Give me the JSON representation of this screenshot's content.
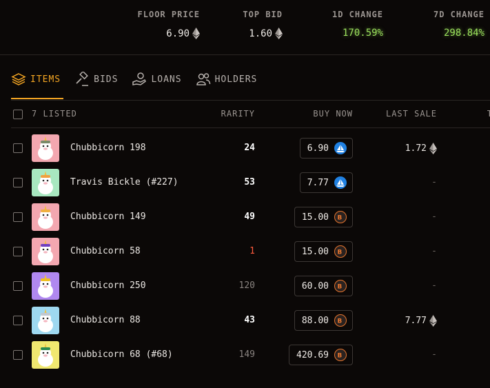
{
  "stats": [
    {
      "label": "FLOOR PRICE",
      "value": "6.90",
      "eth": true
    },
    {
      "label": "TOP BID",
      "value": "1.60",
      "eth": true
    },
    {
      "label": "1D CHANGE",
      "value": "170.59%",
      "eth": false
    },
    {
      "label": "7D CHANGE",
      "value": "298.84%",
      "eth": false
    }
  ],
  "tabs": [
    {
      "label": "ITEMS",
      "icon": "layers-icon",
      "active": true
    },
    {
      "label": "BIDS",
      "icon": "gavel-icon",
      "active": false
    },
    {
      "label": "LOANS",
      "icon": "loan-hand-icon",
      "active": false
    },
    {
      "label": "HOLDERS",
      "icon": "users-icon",
      "active": false
    }
  ],
  "table": {
    "headers": {
      "listed": "7 LISTED",
      "rarity": "RARITY",
      "buy_now": "BUY NOW",
      "last_sale": "LAST SALE",
      "truncated": "T"
    },
    "rows": [
      {
        "name": "Chubbicorn 198",
        "rarity": "24",
        "rarity_style": "bold",
        "price": "6.90",
        "market": "opensea",
        "last_sale": "1.72",
        "last_eth": true,
        "thumb_bg": "#f3a7b0",
        "accent": "#7a8a6a"
      },
      {
        "name": "Travis Bickle (#227)",
        "rarity": "53",
        "rarity_style": "bold",
        "price": "7.77",
        "market": "opensea",
        "last_sale": "-",
        "last_eth": false,
        "thumb_bg": "#a8e8c0",
        "accent": "#f0a040"
      },
      {
        "name": "Chubbicorn 149",
        "rarity": "49",
        "rarity_style": "bold",
        "price": "15.00",
        "market": "blur",
        "last_sale": "-",
        "last_eth": false,
        "thumb_bg": "#f3a7b0",
        "accent": "#f0b040"
      },
      {
        "name": "Chubbicorn 58",
        "rarity": "1",
        "rarity_style": "red",
        "price": "15.00",
        "market": "blur",
        "last_sale": "-",
        "last_eth": false,
        "thumb_bg": "#f3a7b0",
        "accent": "#7040c0"
      },
      {
        "name": "Chubbicorn 250",
        "rarity": "120",
        "rarity_style": "dim",
        "price": "60.00",
        "market": "blur",
        "last_sale": "-",
        "last_eth": false,
        "thumb_bg": "#b088f0",
        "accent": "#f0c020"
      },
      {
        "name": "Chubbicorn 88",
        "rarity": "43",
        "rarity_style": "bold",
        "price": "88.00",
        "market": "blur",
        "last_sale": "7.77",
        "last_eth": true,
        "thumb_bg": "#9ed8f0",
        "accent": "#c0c8d0"
      },
      {
        "name": "Chubbicorn 68 (#68)",
        "rarity": "149",
        "rarity_style": "dim",
        "price": "420.69",
        "market": "blur",
        "last_sale": "-",
        "last_eth": false,
        "thumb_bg": "#f0e870",
        "accent": "#2a8a50"
      }
    ]
  }
}
